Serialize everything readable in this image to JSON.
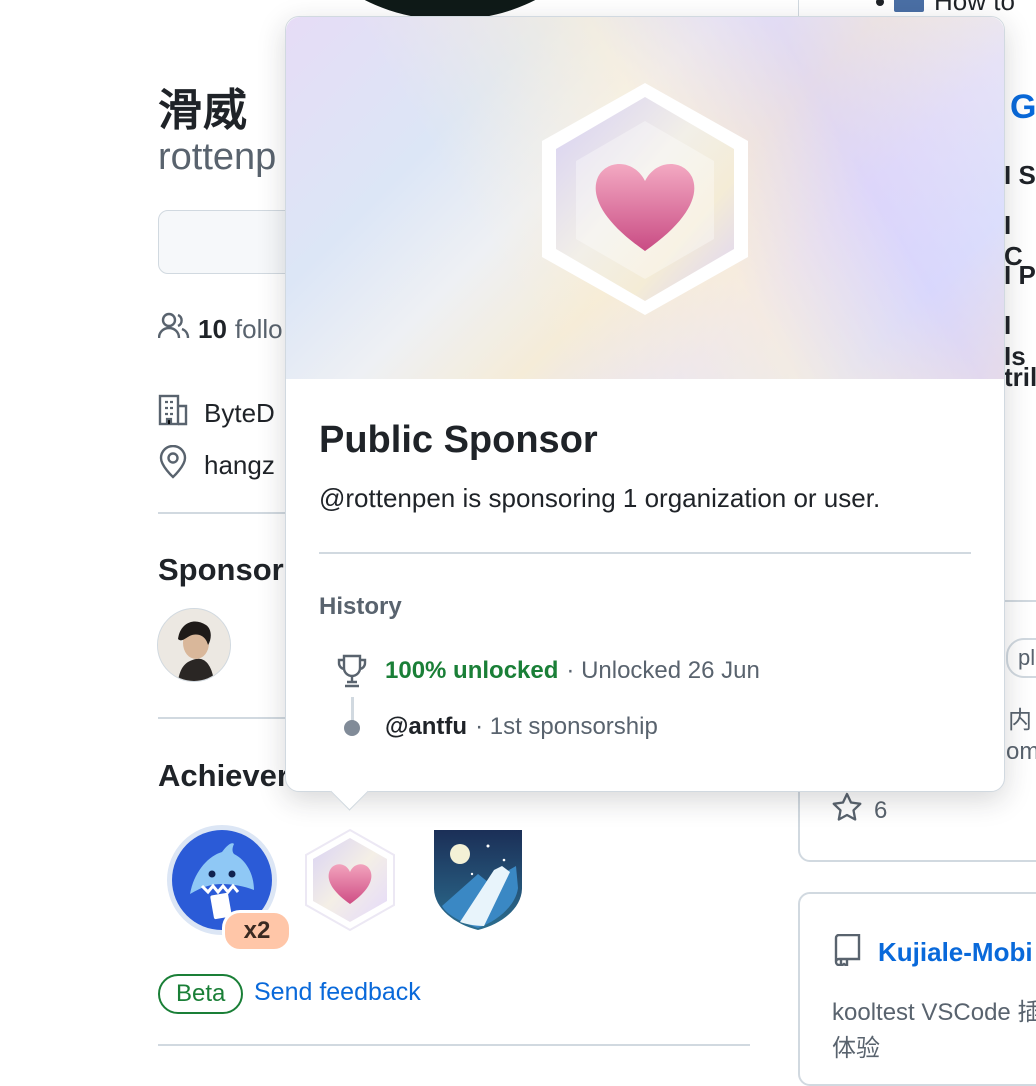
{
  "profile": {
    "display_name": "滑威",
    "login_partial": "rottenp",
    "followers_count": "10",
    "followers_label_partial": "follo",
    "company_partial": "ByteD",
    "location_partial": "hangz"
  },
  "sections": {
    "sponsors_partial": "Sponsor",
    "achievements_partial": "Achiever"
  },
  "achievements": {
    "multiplier": "x2",
    "beta_label": "Beta",
    "feedback_label": "Send feedback"
  },
  "right_column": {
    "top_item_partial": "How to",
    "heading_partial": "G",
    "rows_partial": [
      "I S",
      "I C",
      "I P",
      "I Is",
      "tril"
    ],
    "card1_tag_partial": "plic",
    "card1_desc_line1_partial": "内",
    "card1_desc_line2_partial": "om",
    "card1_stars": "6",
    "card2_repo_partial": "Kujiale-Mobi",
    "card2_desc_line1_partial": "kooltest VSCode 插",
    "card2_desc_line2_partial": "体验"
  },
  "popover": {
    "title": "Public Sponsor",
    "description": "@rottenpen is sponsoring 1 organization or user.",
    "history_label": "History",
    "unlock_percent": "100% unlocked",
    "unlock_date": "· Unlocked 26 Jun",
    "sponsored_user": "@antfu",
    "sponsorship_note": "· 1st sponsorship"
  },
  "colors": {
    "accent_link": "#0969da",
    "success_green": "#1a7f37",
    "border": "#d1d9e0",
    "muted_text": "#59636e",
    "heart_pink": "#d9588d"
  },
  "icons": [
    "people-icon",
    "organization-icon",
    "location-icon",
    "trophy-icon",
    "star-icon",
    "repo-icon",
    "heart-hexagon-icon",
    "shark-achievement-icon",
    "mountain-achievement-icon"
  ]
}
